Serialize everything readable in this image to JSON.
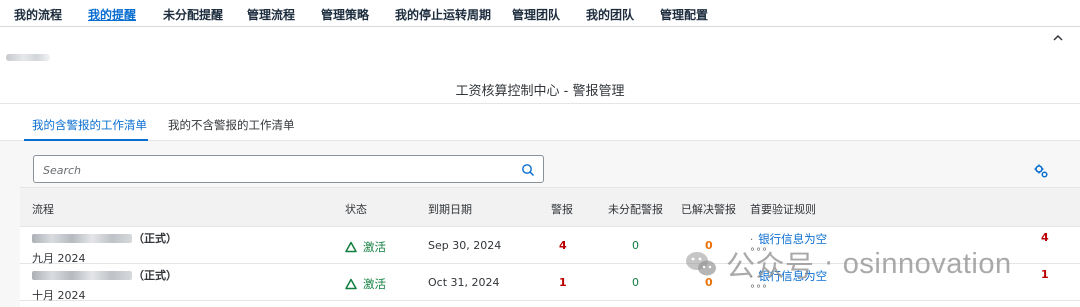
{
  "nav": {
    "items": [
      "我的流程",
      "我的提醒",
      "未分配提醒",
      "管理流程",
      "管理策略",
      "我的停止运转周期",
      "管理团队",
      "我的团队",
      "管理配置"
    ],
    "active_index": 1
  },
  "header": {
    "title": "工资核算控制中心 - 警报管理",
    "collapse_icon": "chevron-up-icon"
  },
  "tabs": [
    {
      "label": "我的含警报的工作清单",
      "active": true
    },
    {
      "label": "我的不含警报的工作清单",
      "active": false
    }
  ],
  "search": {
    "placeholder": "Search",
    "value": ""
  },
  "table": {
    "columns": [
      "流程",
      "状态",
      "到期日期",
      "警报",
      "未分配警报",
      "已解决警报",
      "首要验证规则"
    ],
    "rows": [
      {
        "flow_tag": "（正式）",
        "month": "九月 2024",
        "status": "激活",
        "due_date": "Sep 30, 2024",
        "alerts": "4",
        "unassigned": "0",
        "resolved": "0",
        "top_rule": "银行信息为空",
        "more": "°°°",
        "right_count": "4"
      },
      {
        "flow_tag": "（正式）",
        "month": "十月 2024",
        "status": "激活",
        "due_date": "Oct 31, 2024",
        "alerts": "1",
        "unassigned": "0",
        "resolved": "0",
        "top_rule": "银行信息为空",
        "more": "°°°",
        "right_count": "1"
      }
    ]
  },
  "watermark": {
    "label": "公众号",
    "name": "osinnovation"
  },
  "colors": {
    "accent": "#0a6ed1",
    "positive": "#107e3e",
    "negative": "#bb0000",
    "critical": "#e9730c"
  }
}
